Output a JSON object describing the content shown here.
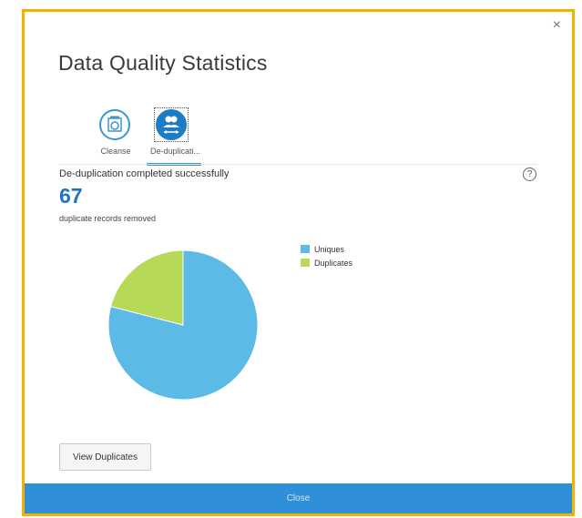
{
  "dialog": {
    "title": "Data Quality Statistics",
    "close_glyph": "×"
  },
  "tabs": [
    {
      "label": "Cleanse",
      "icon": "cleanse-icon",
      "selected": false
    },
    {
      "label": "De-duplicati...",
      "icon": "users-merge-icon",
      "selected": true
    }
  ],
  "result": {
    "status": "De-duplication completed successfully",
    "count": "67",
    "caption": "duplicate records removed",
    "help_glyph": "?"
  },
  "chart_data": {
    "type": "pie",
    "labels": [
      "Uniques",
      "Duplicates"
    ],
    "values": [
      79,
      21
    ],
    "colors": [
      "#5bbae6",
      "#b6d957"
    ],
    "legend_position": "top-right"
  },
  "buttons": {
    "view_duplicates": "View Duplicates",
    "close": "Close"
  },
  "colors": {
    "accent": "#2f8fd8",
    "border": "#f0b400",
    "number": "#1f74c0"
  }
}
